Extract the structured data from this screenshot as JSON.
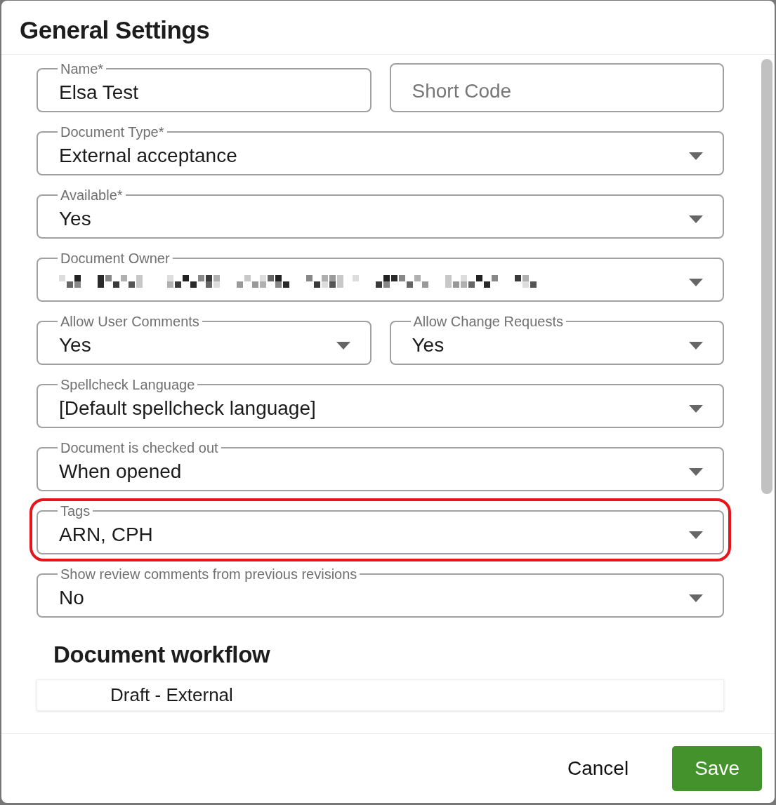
{
  "dialog": {
    "title": "General Settings"
  },
  "rows": [
    {
      "fields": [
        {
          "kind": "text",
          "label": "Name*",
          "value": "Elsa Test"
        },
        {
          "kind": "text",
          "placeholder": "Short Code"
        }
      ]
    },
    {
      "fields": [
        {
          "kind": "select",
          "label": "Document Type*",
          "value": "External acceptance"
        }
      ]
    },
    {
      "fields": [
        {
          "kind": "select",
          "label": "Available*",
          "value": "Yes"
        }
      ]
    },
    {
      "fields": [
        {
          "kind": "select",
          "label": "Document Owner",
          "redacted": true
        }
      ]
    },
    {
      "fields": [
        {
          "kind": "select",
          "label": "Allow User Comments",
          "value": "Yes"
        },
        {
          "kind": "select",
          "label": "Allow Change Requests",
          "value": "Yes"
        }
      ]
    },
    {
      "fields": [
        {
          "kind": "select",
          "label": "Spellcheck Language",
          "value": "[Default spellcheck language]"
        }
      ]
    },
    {
      "fields": [
        {
          "kind": "select",
          "label": "Document is checked out",
          "value": "When opened"
        }
      ]
    },
    {
      "fields": [
        {
          "kind": "select",
          "label": "Tags",
          "value": "ARN, CPH",
          "highlighted": true
        }
      ]
    },
    {
      "fields": [
        {
          "kind": "select",
          "label": "Show review comments from previous revisions",
          "value": "No"
        }
      ]
    }
  ],
  "workflow": {
    "heading": "Document workflow",
    "steps": [
      "Draft - External"
    ]
  },
  "buttons": [
    {
      "kind": "text",
      "label": "Cancel"
    },
    {
      "kind": "primary",
      "label": "Save"
    }
  ]
}
